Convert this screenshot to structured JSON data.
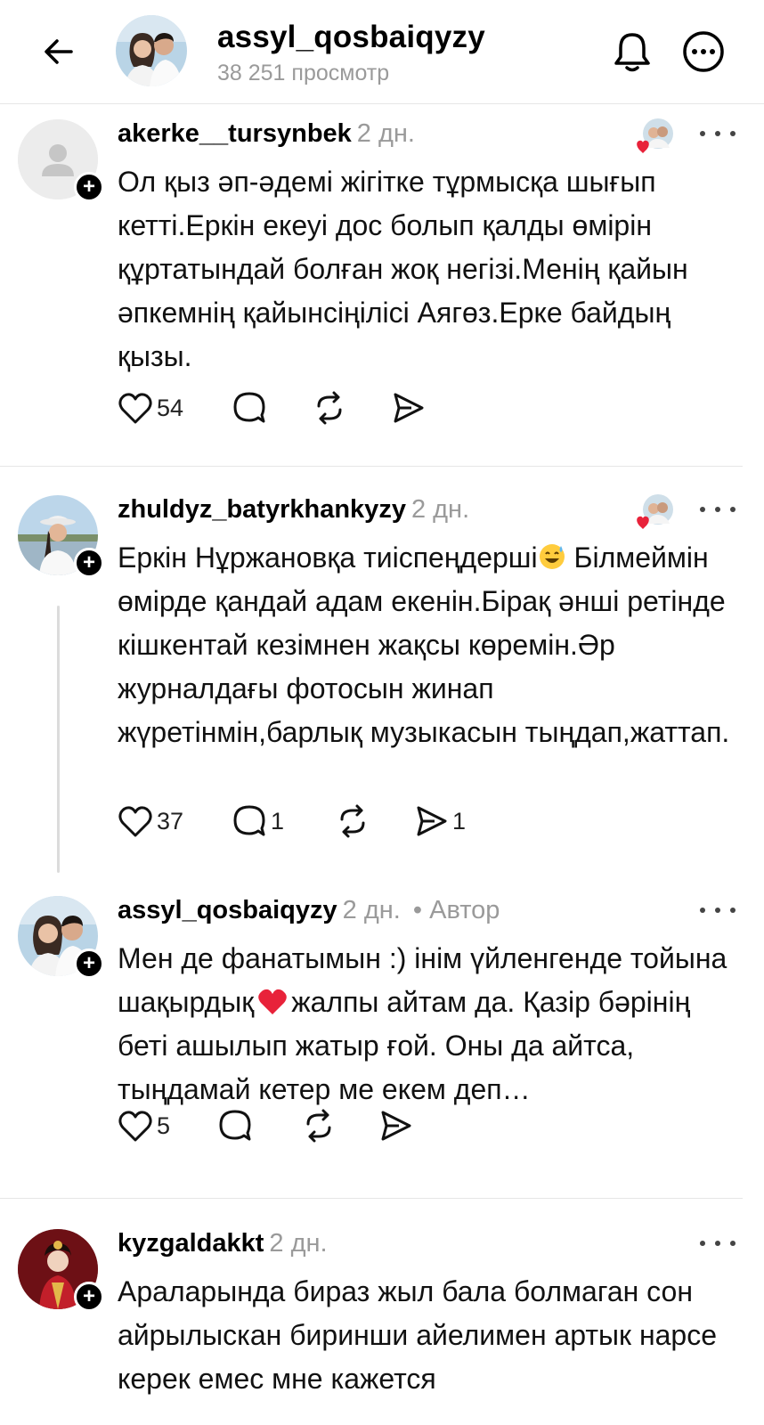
{
  "header": {
    "username": "assyl_qosbaiqyzy",
    "views": "38 251 просмотр"
  },
  "comments": [
    {
      "username": "akerke__tursynbek",
      "time": "2 дн.",
      "text": "Ол қыз әп-әдемі жігітке тұрмысқа шығып кетті.Еркін екеуі дос болып қалды өмірін құртатындай болған жоқ негізі.Менің қайын әпкемнің қайынсіңілісі Аягөз.Ерке байдың қызы.",
      "likes": "54",
      "replies": "",
      "shares": ""
    },
    {
      "username": "zhuldyz_batyrkhankyzy",
      "time": "2 дн.",
      "text_before_emoji": "Еркін Нұржановқа тиіспеңдерші",
      "text_after_emoji": "Білмеймін өмірде қандай адам екенін.Бірақ әнші ретінде кішкентай кезімнен жақсы көремін.Әр журналдағы фотосын жинап жүретінмін,барлық музыкасын тыңдап,жаттап.",
      "likes": "37",
      "replies": "1",
      "shares": "1"
    },
    {
      "username": "assyl_qosbaiqyzy",
      "time": "2 дн.",
      "author_tag": "• Автор",
      "text_before_emoji": "Мен де фанатымын :) інім үйленгенде тойына шақырдық",
      "text_after_emoji": "жалпы айтам да. Қазір бәрінің беті ашылып жатыр ғой. Оны да айтса, тыңдамай кетер ме екем деп…",
      "likes": "5"
    },
    {
      "username": "kyzgaldakkt",
      "time": "2 дн.",
      "text": "Араларында бираз жыл бала болмаган сон айрылыскан биринши айелимен артык нарсе керек емес мне кажется"
    }
  ],
  "icons": {
    "back": "arrow-left-icon",
    "bell": "bell-icon",
    "more": "more-horizontal-icon",
    "like": "heart-icon",
    "reply": "comment-bubble-icon",
    "repost": "repost-icon",
    "share": "send-icon"
  },
  "colors": {
    "muted": "#9a9a9a",
    "heart_red": "#e8223a",
    "divider": "#e6e6e6"
  }
}
